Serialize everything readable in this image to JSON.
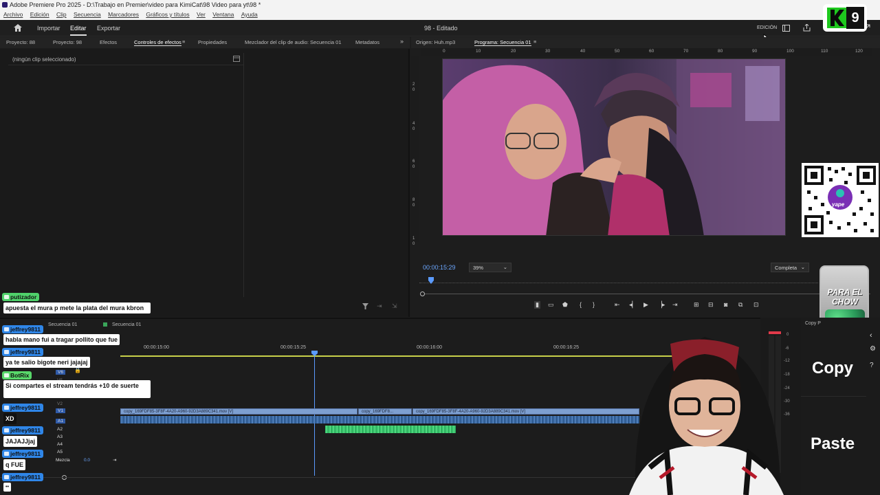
{
  "window": {
    "title": "Adobe Premiere Pro 2025 - D:\\Trabajo en Premier\\video para KimiCat\\98 Video para yt\\98 *"
  },
  "menu": [
    "Archivo",
    "Edición",
    "Clip",
    "Secuencia",
    "Marcadores",
    "Gráficos y títulos",
    "Ver",
    "Ventana",
    "Ayuda"
  ],
  "appbar": {
    "import": "Importar",
    "edit": "Editar",
    "export": "Exportar",
    "doc_title": "98 - Editado",
    "mode": "EDICIÓN"
  },
  "left_tabs": [
    "Proyecto: 88",
    "Proyecto: 98",
    "Efectos",
    "Controles de efectos",
    "Propiedades",
    "Mezclador del clip de audio: Secuencia 01",
    "Metadatos"
  ],
  "effect_controls": {
    "empty": "(ningún clip seleccionado)"
  },
  "program_tabs": {
    "source": "Origen: Huh.mp3",
    "program": "Programa: Secuencia 01"
  },
  "ruler_ticks": [
    "0",
    "10",
    "20",
    "30",
    "40",
    "50",
    "60",
    "70",
    "80",
    "90",
    "100",
    "110",
    "120"
  ],
  "vruler_ticks": [
    "2",
    "0",
    "4",
    "0",
    "6",
    "0",
    "8",
    "0",
    "1",
    "0"
  ],
  "program": {
    "timecode": "00:00:15:29",
    "zoom": "39%",
    "quality": "Completa"
  },
  "timeline": {
    "seq_tab": "Secuencia 01",
    "seq_tab2": "Secuencia 01",
    "times": [
      "00:00:15:00",
      "00:00:15:25",
      "00:00:16:00",
      "00:00:16:25"
    ],
    "clips": [
      {
        "label": "copy_169FDF85-3F8F-4A20-A960-92D3A889C341.mov [V]"
      },
      {
        "label": "copy_169FDF8..."
      },
      {
        "label": "copy_169FDF85-3F8F-4A20-A960-92D3A889C341.mov [V]"
      }
    ],
    "tracks": [
      "V6",
      "V5",
      "V2",
      "V1",
      "A1",
      "A2",
      "A3",
      "A4",
      "A5"
    ],
    "mix_label": "Mezcla",
    "mix_value": "0.0",
    "meter_ticks": [
      "0",
      "-6",
      "-12",
      "-18",
      "-24",
      "-30",
      "-36"
    ]
  },
  "overlay": {
    "badge_number": "9",
    "qr_caption": "yape",
    "jar_text": "PARA EL CHOW",
    "copy_label": "Copy",
    "paste_label": "Paste",
    "copy_small": "Copy P"
  },
  "chat": [
    {
      "name": "putizador",
      "color": "#4fd16a",
      "msg": "apuesta el mura p mete la plata del mura kbron"
    },
    {
      "name": "jeffrey9811",
      "color": "#2f86e8",
      "msg": "habla mano fui a tragar pollito que fue"
    },
    {
      "name": "jeffrey9811",
      "color": "#2f86e8",
      "msg": "ya te salio bigote neri jajajaj"
    },
    {
      "name": "BotRix",
      "color": "#58d86a",
      "msg": "Si compartes el stream tendrás +10 de suerte"
    },
    {
      "name": "jeffrey9811",
      "color": "#2f86e8",
      "msg": "XD"
    },
    {
      "name": "jeffrey9811",
      "color": "#2f86e8",
      "msg": "JAJAJJjaj"
    },
    {
      "name": "jeffrey9811",
      "color": "#2f86e8",
      "msg": "q FUE"
    },
    {
      "name": "jeffrey9811",
      "color": "#2f86e8",
      "msg": "••"
    }
  ]
}
